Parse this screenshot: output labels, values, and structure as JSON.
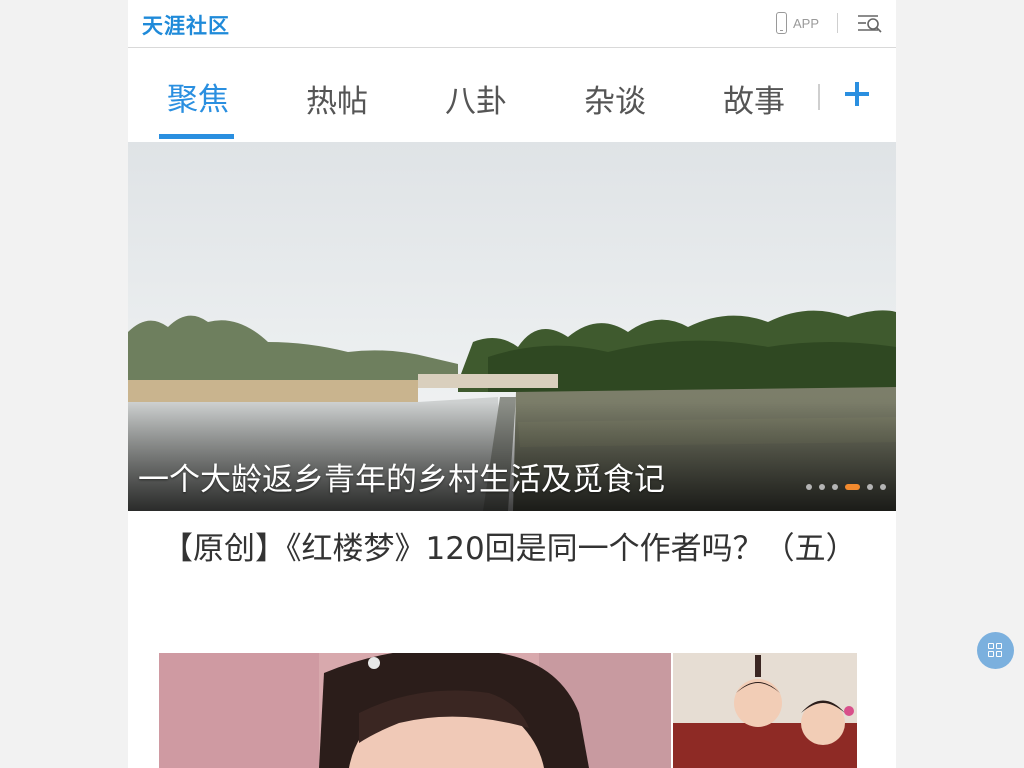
{
  "brand": {
    "logo_text": "天涯社区",
    "accent": "#2a8fe0"
  },
  "header": {
    "app_label": "APP",
    "menu_icon": "menu-search-icon"
  },
  "tabs": [
    {
      "label": "聚焦",
      "active": true
    },
    {
      "label": "热帖",
      "active": false
    },
    {
      "label": "八卦",
      "active": false
    },
    {
      "label": "杂谈",
      "active": false
    },
    {
      "label": "故事",
      "active": false
    }
  ],
  "banner": {
    "title": "一个大龄返乡青年的乡村生活及觅食记",
    "dot_count": 6,
    "active_dot": 4
  },
  "article": {
    "title": "【原创】《红楼梦》120回是同一个作者吗？（五）"
  },
  "float_button": {
    "icon": "grid-icon"
  }
}
